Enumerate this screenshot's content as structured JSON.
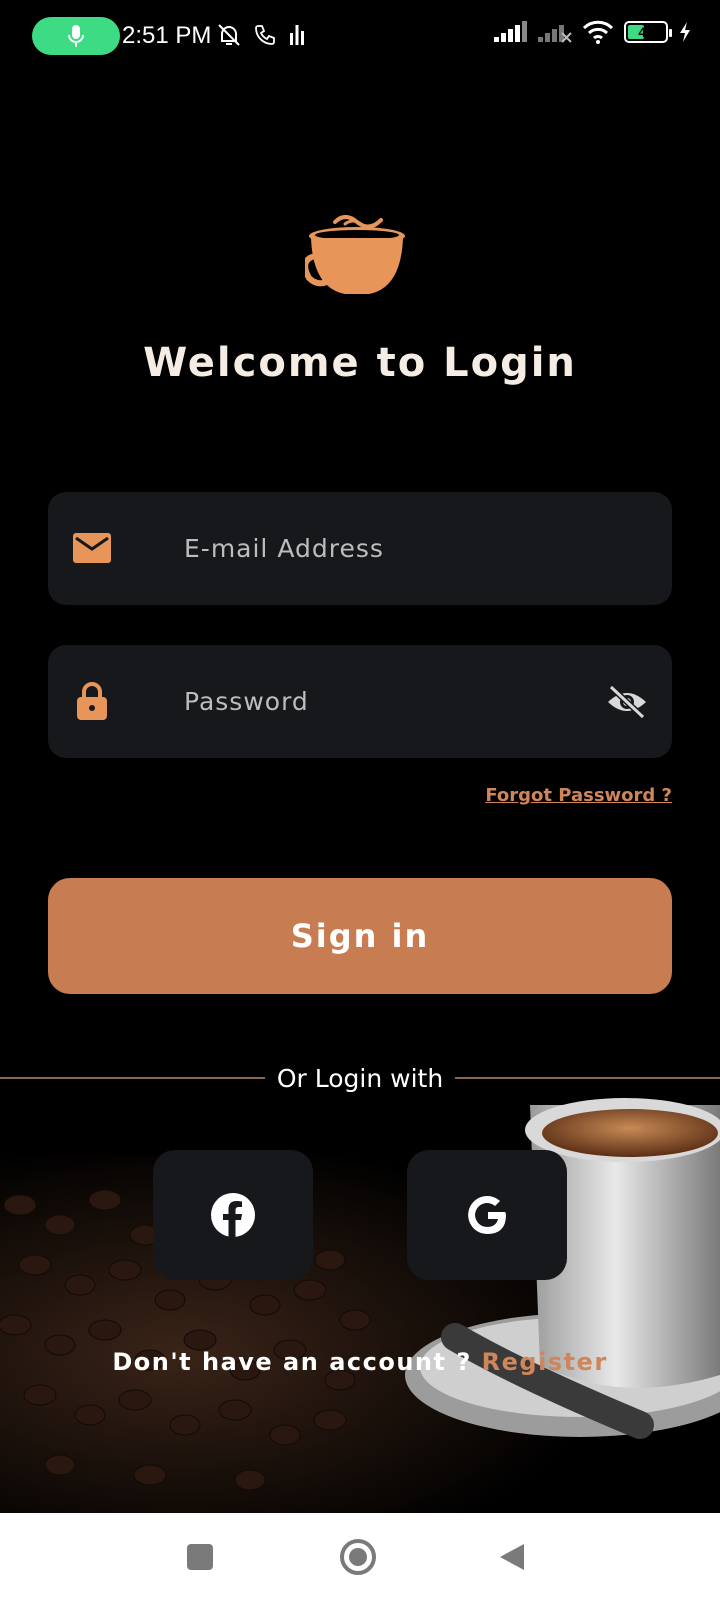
{
  "status_bar": {
    "time": "2:51 PM",
    "battery_level": "40",
    "icons": [
      "mic-icon",
      "bell-off-icon",
      "phone-icon",
      "audio-bars-icon",
      "signal-icon",
      "signal-off-icon",
      "wifi-icon",
      "battery-icon",
      "charging-icon"
    ]
  },
  "header": {
    "logo": "coffee-cup-icon",
    "title": "Welcome to Login"
  },
  "form": {
    "email_placeholder": "E-mail Address",
    "password_placeholder": "Password",
    "forgot_label": "Forgot Password ?",
    "signin_label": "Sign in"
  },
  "social": {
    "divider_label": "Or Login with",
    "buttons": [
      "facebook-icon",
      "google-icon"
    ]
  },
  "footer": {
    "prompt": "Don't have an account ?",
    "register_label": "Register"
  },
  "colors": {
    "accent": "#c77d51",
    "field_bg": "#17181c",
    "background": "#000000",
    "status_green": "#3ddc84"
  }
}
